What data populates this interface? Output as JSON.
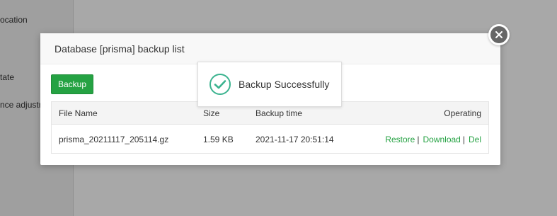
{
  "background": {
    "labels": [
      "ocation",
      "tate",
      "nce adjustm"
    ]
  },
  "modal": {
    "title": "Database [prisma] backup list",
    "backup_button": "Backup",
    "table": {
      "headers": [
        "File Name",
        "Size",
        "Backup time",
        "Operating"
      ],
      "rows": [
        {
          "file_name": "prisma_20211117_205114.gz",
          "size": "1.59 KB",
          "backup_time": "2021-11-17 20:51:14",
          "actions": [
            "Restore",
            "Download",
            "Del"
          ]
        }
      ]
    }
  },
  "toast": {
    "message": "Backup Successfully"
  },
  "icons": {
    "close": "close-icon",
    "success": "check-circle-icon"
  },
  "colors": {
    "accent": "#25a243",
    "success_icon": "#3bb38f",
    "overlay": "#a5a5a5"
  }
}
